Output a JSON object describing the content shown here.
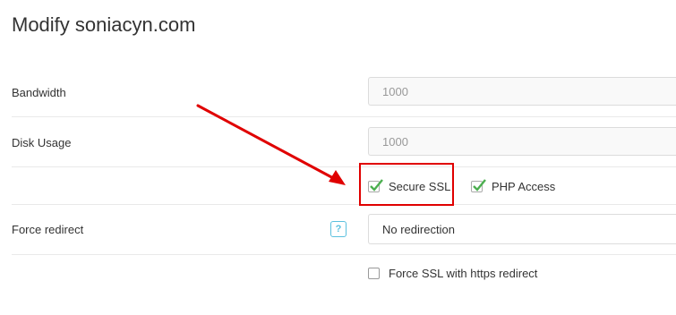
{
  "page": {
    "title": "Modify soniacyn.com"
  },
  "bandwidth": {
    "label": "Bandwidth",
    "value": "1000"
  },
  "disk_usage": {
    "label": "Disk Usage",
    "value": "1000"
  },
  "options": {
    "secure_ssl": {
      "label": "Secure SSL",
      "checked": true
    },
    "php_access": {
      "label": "PHP Access",
      "checked": true
    }
  },
  "force_redirect": {
    "label": "Force redirect",
    "help": "?",
    "selected": "No redirection"
  },
  "force_ssl": {
    "label": "Force SSL with https redirect",
    "checked": false
  },
  "colors": {
    "annotation": "#e00000",
    "check": "#4caf50",
    "help": "#5bc0de"
  }
}
